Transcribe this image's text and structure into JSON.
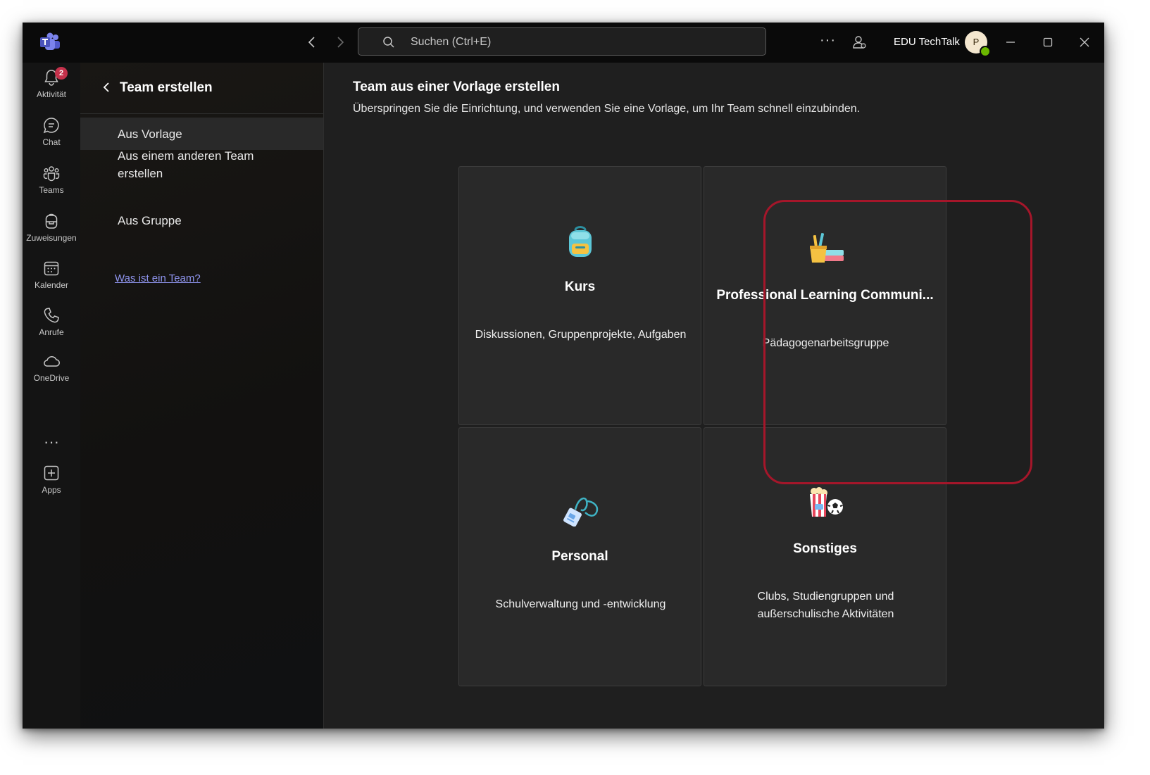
{
  "titlebar": {
    "search_placeholder": "Suchen (Ctrl+E)",
    "more": "···",
    "user_name": "EDU TechTalk",
    "avatar_initial": "P"
  },
  "appbar": {
    "items": [
      {
        "label": "Aktivität",
        "icon": "bell-icon",
        "badge": "2"
      },
      {
        "label": "Chat",
        "icon": "chat-icon"
      },
      {
        "label": "Teams",
        "icon": "teams-icon"
      },
      {
        "label": "Zuweisungen",
        "icon": "backpack-icon"
      },
      {
        "label": "Kalender",
        "icon": "calendar-icon"
      },
      {
        "label": "Anrufe",
        "icon": "phone-icon"
      },
      {
        "label": "OneDrive",
        "icon": "cloud-icon"
      },
      {
        "label": "Apps",
        "icon": "add-app-icon"
      }
    ],
    "more": "···"
  },
  "left_panel": {
    "title": "Team erstellen",
    "menu": [
      {
        "label": "Aus Vorlage",
        "active": true
      },
      {
        "label": "Aus einem anderen Team erstellen"
      },
      {
        "label": "Aus Gruppe"
      }
    ],
    "link": "Was ist ein Team?"
  },
  "main": {
    "title": "Team aus einer Vorlage erstellen",
    "subtitle": "Überspringen Sie die Einrichtung, und verwenden Sie eine Vorlage, um Ihr Team schnell einzubinden.",
    "cards": [
      {
        "title": "Kurs",
        "description": "Diskussionen, Gruppenprojekte, Aufgaben",
        "icon": "backpack-icon",
        "highlighted": true
      },
      {
        "title": "Professional Learning Communi...",
        "description": "Pädagogenarbeitsgruppe",
        "icon": "pencil-cup-icon"
      },
      {
        "title": "Personal",
        "description": "Schulverwaltung und -entwicklung",
        "icon": "badge-lanyard-icon"
      },
      {
        "title": "Sonstiges",
        "description": "Clubs, Studiengruppen und außerschulische Aktivitäten",
        "icon": "popcorn-ball-icon"
      }
    ]
  },
  "colors": {
    "accent": "#8f95ef",
    "highlight": "#a5162a",
    "badge": "#c4314b",
    "status": "#6bb700"
  }
}
